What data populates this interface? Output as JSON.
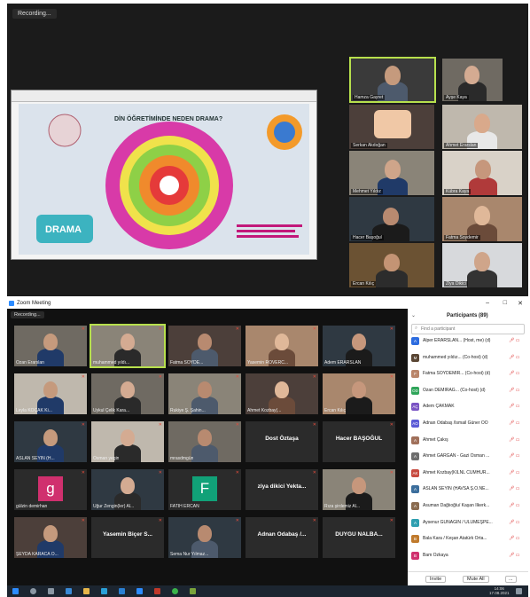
{
  "top_meeting": {
    "recording_label": "Recording...",
    "slide_title": "DİN ÖĞRETİMİNDE NEDEN DRAMA?",
    "slide_badge": "DRAMA",
    "tiles": [
      {
        "name": "Hamza Gayret"
      },
      {
        "name": "Ayşe Kaya"
      },
      {
        "name": "Serkan Akdoğan"
      },
      {
        "name": "Ahmet Erarslan"
      },
      {
        "name": "Mehmet Yıldız"
      },
      {
        "name": "Kübra Kaya"
      },
      {
        "name": "Hacer Başoğul"
      },
      {
        "name": "Fatma Soydemir"
      },
      {
        "name": "Ercan Kılıç"
      },
      {
        "name": "Ziya Dikici"
      }
    ]
  },
  "zoom": {
    "window_title": "Zoom Meeting",
    "recording_label": "Recording...",
    "tiles": [
      {
        "name": "Ozan Erarslan",
        "type": "video"
      },
      {
        "name": "muhammed yıldı...",
        "type": "video"
      },
      {
        "name": "Fatma SOYDE...",
        "type": "video"
      },
      {
        "name": "Yasemin ROVERC...",
        "type": "video"
      },
      {
        "name": "Adem ERARSLAN",
        "type": "video"
      },
      {
        "name": "Leyla KOÇAK Ki...",
        "type": "video"
      },
      {
        "name": "Uykul Çelik Kara...",
        "type": "video"
      },
      {
        "name": "Rukiye Ş. Şahin...",
        "type": "video"
      },
      {
        "name": "Ahmet Kozbay(...",
        "type": "video"
      },
      {
        "name": "Ercan Kılıç",
        "type": "video"
      },
      {
        "name": "ASLAN SEYİN (H...",
        "type": "video"
      },
      {
        "name": "Osman yegin",
        "type": "video"
      },
      {
        "name": "mrasdmgün",
        "type": "video"
      },
      {
        "name": "Dost Öztaşa",
        "type": "name"
      },
      {
        "name": "Hacer BAŞOĞUL",
        "type": "name"
      },
      {
        "name": "gülzin demirhan",
        "type": "avatar",
        "initial": "g",
        "color": "#d0306e"
      },
      {
        "name": "Uğur Zengin(ler) Al...",
        "type": "video"
      },
      {
        "name": "FATİH ERCAN",
        "type": "avatar",
        "initial": "F",
        "color": "#11a178"
      },
      {
        "name": "ziya dikici Yekta...",
        "type": "name"
      },
      {
        "name": "Rıza şirdemiz Al...",
        "type": "video"
      },
      {
        "name": "ŞEYDA KARACA Ö...",
        "type": "video"
      },
      {
        "name": "Yasemin Biçer S...",
        "type": "name"
      },
      {
        "name": "Sema Nur Yılmaz...",
        "type": "video"
      },
      {
        "name": "Adnan Odabaş /...",
        "type": "name"
      },
      {
        "name": "DUYGU NALBA...",
        "type": "name"
      }
    ],
    "participants": {
      "title": "Participants (89)",
      "search_placeholder": "Find a participant",
      "rows": [
        {
          "name": "Alper ERARSLAN... (Host, me) (d)",
          "initial": "A",
          "color": "#2d6cdf"
        },
        {
          "name": "muhammed yıldız... (Co-host) (d)",
          "initial": "M",
          "color": "#5a4634"
        },
        {
          "name": "Fatma SOYDEMİR... (Co-host) (d)",
          "initial": "F",
          "color": "#b9856a"
        },
        {
          "name": "Ozan DEMİRAĞ... (Co-host) (d)",
          "initial": "OD",
          "color": "#2fa55a"
        },
        {
          "name": "Adem ÇAKMAK",
          "initial": "AÇ",
          "color": "#7a54c4"
        },
        {
          "name": "Adnan Odabaş /İsmail Güner OO",
          "initial": "AO",
          "color": "#5b5bd6"
        },
        {
          "name": "Ahmet Çakış",
          "initial": "A",
          "color": "#a0705a"
        },
        {
          "name": "Ahmet GARGAN - Gazi Osman ...",
          "initial": "A",
          "color": "#6e6e6e"
        },
        {
          "name": "Ahmet Kozbay(KILNL CUMHUR...",
          "initial": "AK",
          "color": "#c74a3f"
        },
        {
          "name": "ASLAN SEYİN (HAVSA Ş.Ö.NE...",
          "initial": "A",
          "color": "#3c6e9c"
        },
        {
          "name": "Asuman Dağlıoğlu/ Kaşan İlkerk...",
          "initial": "A",
          "color": "#8a6b4f"
        },
        {
          "name": "Aysenur GÜNAĞIN / ULUMEŞPE...",
          "initial": "A",
          "color": "#2f9fb0"
        },
        {
          "name": "Bala Kara / Keşan Atatürk Orta...",
          "initial": "B",
          "color": "#c07a2c"
        },
        {
          "name": "Bam Özkaya",
          "initial": "B",
          "color": "#d0306e"
        }
      ],
      "invite_label": "Invite",
      "mute_all_label": "Mute All",
      "more_label": "..."
    },
    "taskbar": {
      "time": "14:06",
      "date": "17.08.2021"
    }
  }
}
